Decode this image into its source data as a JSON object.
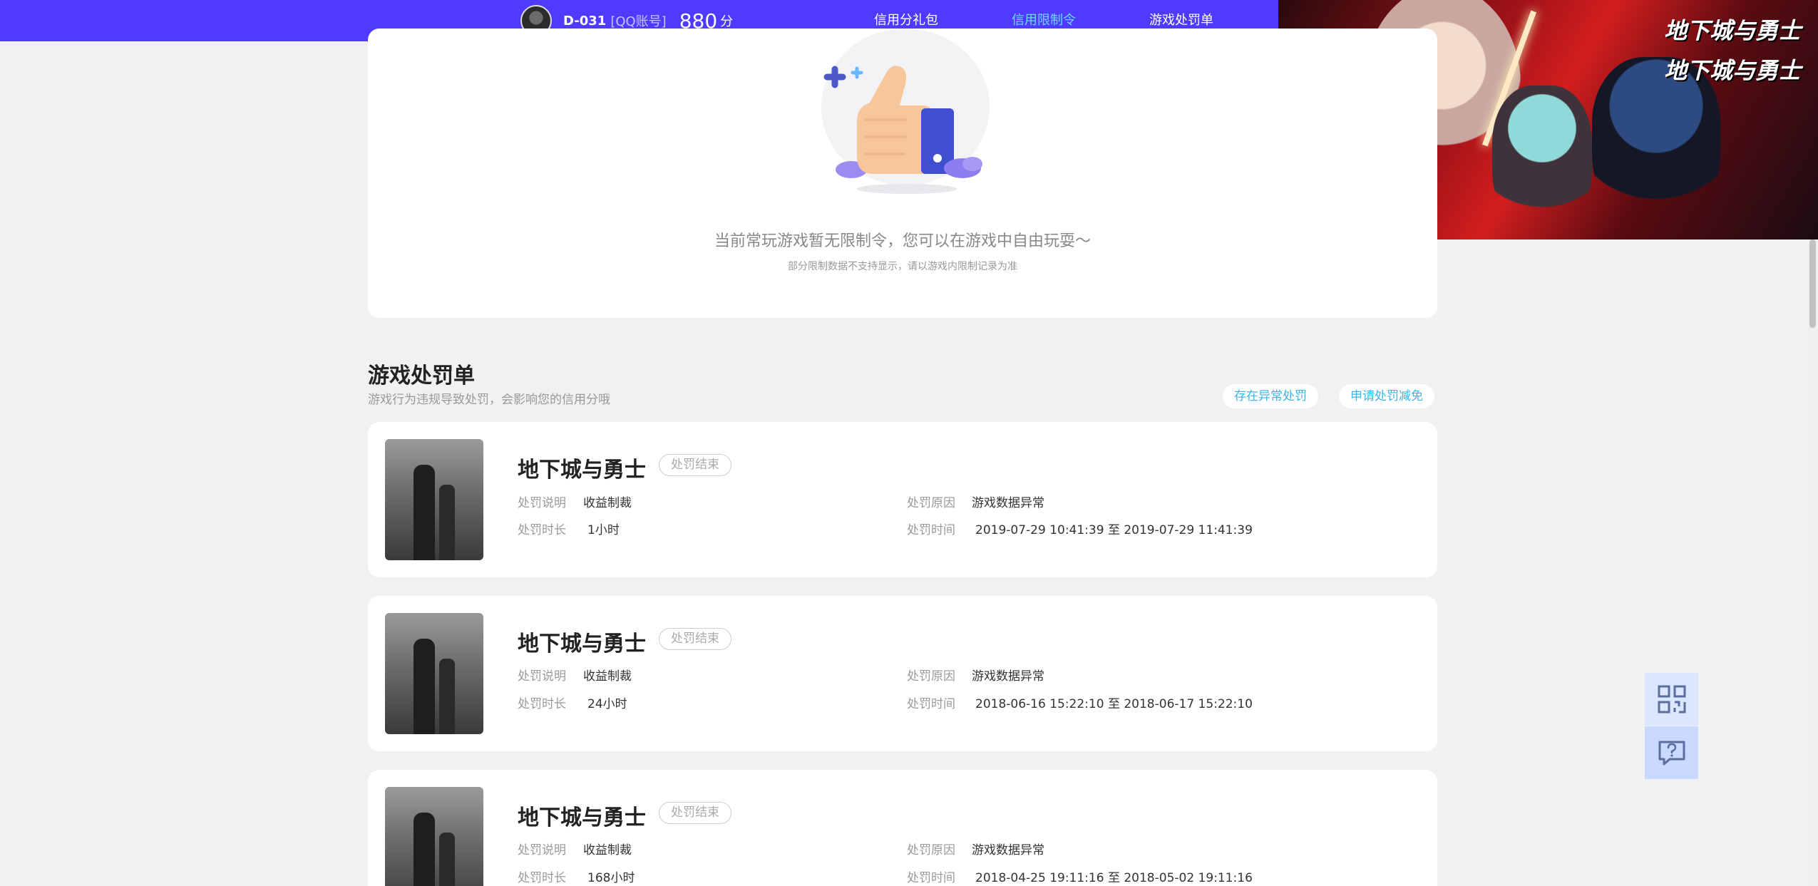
{
  "header": {
    "username": "D-031",
    "account_type": "[QQ账号]",
    "credit_score": "880",
    "score_unit": "分",
    "tabs": [
      {
        "label": "信用分礼包",
        "active": false
      },
      {
        "label": "信用限制令",
        "active": true
      },
      {
        "label": "游戏处罚单",
        "active": false
      }
    ]
  },
  "banner": {
    "logo_text": "地下城与勇士"
  },
  "restriction": {
    "message": "当前常玩游戏暂无限制令，您可以在游戏中自由玩耍～",
    "note": "部分限制数据不支持显示，请以游戏内限制记录为准"
  },
  "penalty_section": {
    "title": "游戏处罚单",
    "subtitle": "游戏行为违规导致处罚，会影响您的信用分哦",
    "action_abnormal": "存在异常处罚",
    "action_appeal": "申请处罚减免",
    "labels": {
      "desc": "处罚说明",
      "duration": "处罚时长",
      "reason": "处罚原因",
      "time": "处罚时间"
    },
    "items": [
      {
        "game": "地下城与勇士",
        "status": "处罚结束",
        "desc": "收益制裁",
        "duration": "1小时",
        "reason": "游戏数据异常",
        "time": "2019-07-29 10:41:39 至 2019-07-29 11:41:39"
      },
      {
        "game": "地下城与勇士",
        "status": "处罚结束",
        "desc": "收益制裁",
        "duration": "24小时",
        "reason": "游戏数据异常",
        "time": "2018-06-16 15:22:10 至 2018-06-17 15:22:10"
      },
      {
        "game": "地下城与勇士",
        "status": "处罚结束",
        "desc": "收益制裁",
        "duration": "168小时",
        "reason": "游戏数据异常",
        "time": "2018-04-25 19:11:16 至 2018-05-02 19:11:16"
      }
    ]
  },
  "theme": {
    "nav_bg": "#4f3bff",
    "active_tab": "#6ad7ff",
    "link": "#3bb6e8"
  }
}
